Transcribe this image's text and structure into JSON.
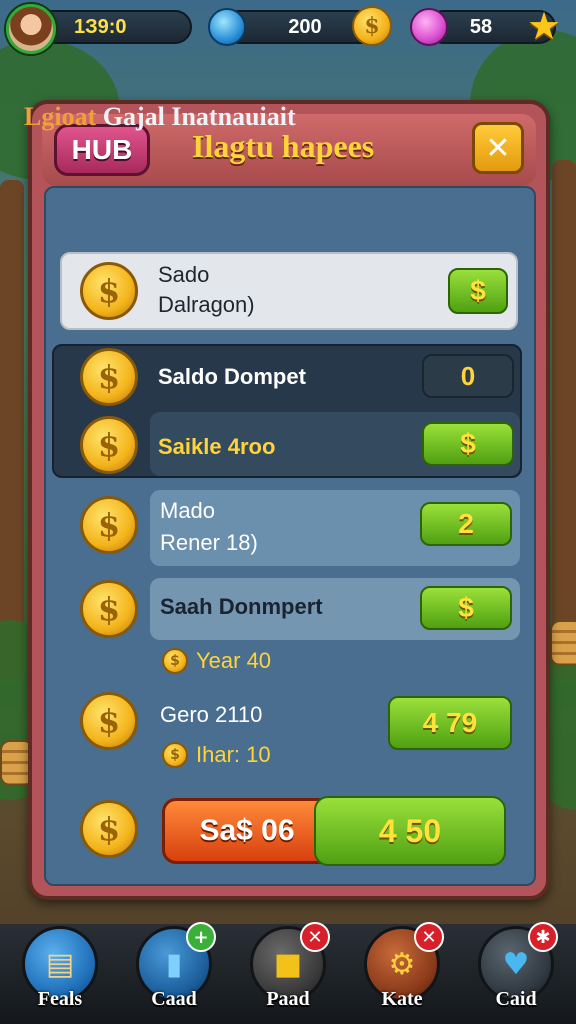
{
  "hud": {
    "level_text": "1З9:0",
    "gems_value": "200",
    "lives_value": "58"
  },
  "panel": {
    "hub_label": "HUB",
    "title": "Ilagtu hapees",
    "close_symbol": "✕",
    "subtitle_part1": "Lgioat",
    "subtitle_part2": "Gajal Inatnauiait"
  },
  "rows": [
    {
      "line1": "Sado",
      "line2": "Dalragon)",
      "button": "$"
    },
    {
      "label": "Saldo Dompet",
      "value": "0"
    },
    {
      "label": "Saikle 4roo",
      "button": "$"
    },
    {
      "line1": "Mado",
      "line2": "Rener 18)",
      "button": "2"
    },
    {
      "label": "Saah Donmpert",
      "button": "$",
      "sub": "Year 40"
    },
    {
      "line1": "Gero 2110",
      "sub": "Ihar: 10",
      "button": "4 79"
    }
  ],
  "footer": {
    "orange_label": "Sa$ 06",
    "green_label": "4 50"
  },
  "coin_symbol": "$",
  "nav": [
    {
      "label": "Feals",
      "icon": "cards-icon",
      "color": "#1f6fb8"
    },
    {
      "label": "Caad",
      "icon": "bottle-icon",
      "color": "#1c5e9c",
      "badge": "+"
    },
    {
      "label": "Paad",
      "icon": "box-icon",
      "color": "#3a3a3a",
      "badge": "✕"
    },
    {
      "label": "Kate",
      "icon": "gear-icon",
      "color": "#8a3a1a",
      "badge": "✕"
    },
    {
      "label": "Caid",
      "icon": "heart-icon",
      "color": "#303840",
      "badge": "✱"
    }
  ],
  "colors": {
    "accent_gold": "#ffd43a",
    "button_green": "#4fa012",
    "button_orange": "#e8501a",
    "panel_red": "#b3545a",
    "panel_blue": "#4a6e8f"
  }
}
